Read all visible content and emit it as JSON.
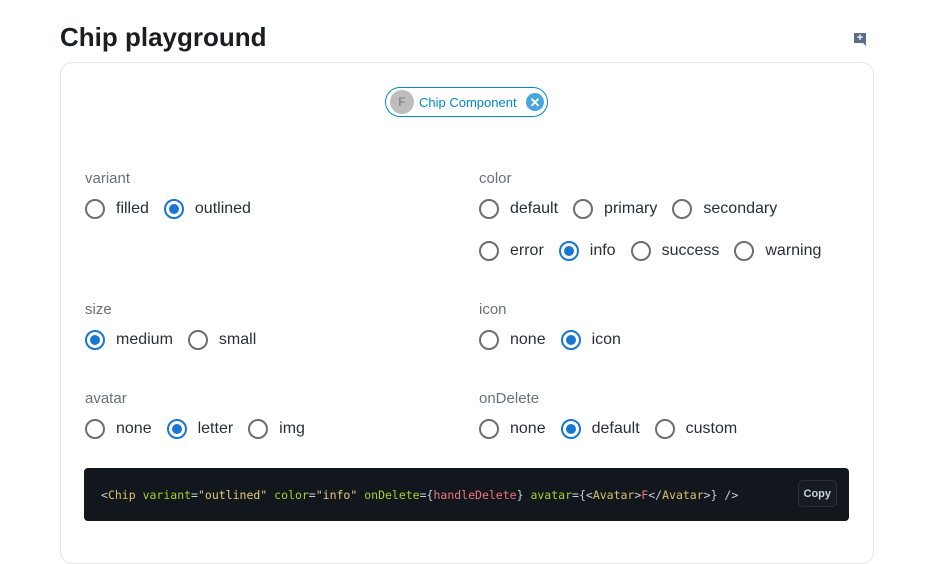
{
  "title": "Chip playground",
  "chip": {
    "avatar": "F",
    "label": "Chip Component",
    "delete_icon": "cancel-icon"
  },
  "groups": {
    "variant": {
      "label": "variant",
      "options": [
        "filled",
        "outlined"
      ],
      "selected": "outlined"
    },
    "size": {
      "label": "size",
      "options": [
        "medium",
        "small"
      ],
      "selected": "medium"
    },
    "avatar": {
      "label": "avatar",
      "options": [
        "none",
        "letter",
        "img"
      ],
      "selected": "letter"
    },
    "color": {
      "label": "color",
      "options": [
        "default",
        "primary",
        "secondary",
        "error",
        "info",
        "success",
        "warning"
      ],
      "selected": "info"
    },
    "icon": {
      "label": "icon",
      "options": [
        "none",
        "icon"
      ],
      "selected": "icon"
    },
    "onDelete": {
      "label": "onDelete",
      "options": [
        "none",
        "default",
        "custom"
      ],
      "selected": "default"
    }
  },
  "code": {
    "lt": "<",
    "chip": "Chip",
    "sp": " ",
    "variant_attr": "variant",
    "eq": "=",
    "variant_val": "\"outlined\"",
    "color_attr": "color",
    "color_val": "\"info\"",
    "ondelete_attr": "onDelete",
    "lb": "{",
    "handler": "handleDelete",
    "rb": "}",
    "avatar_attr": "avatar",
    "avatar_tag": "Avatar",
    "gt": ">",
    "letter": "F",
    "close_lt": "</",
    "end": "} />",
    "copy_label": "Copy"
  },
  "colors": {
    "accent": "#1976d2",
    "chip": "#0288d1",
    "code_bg": "#12161d"
  }
}
